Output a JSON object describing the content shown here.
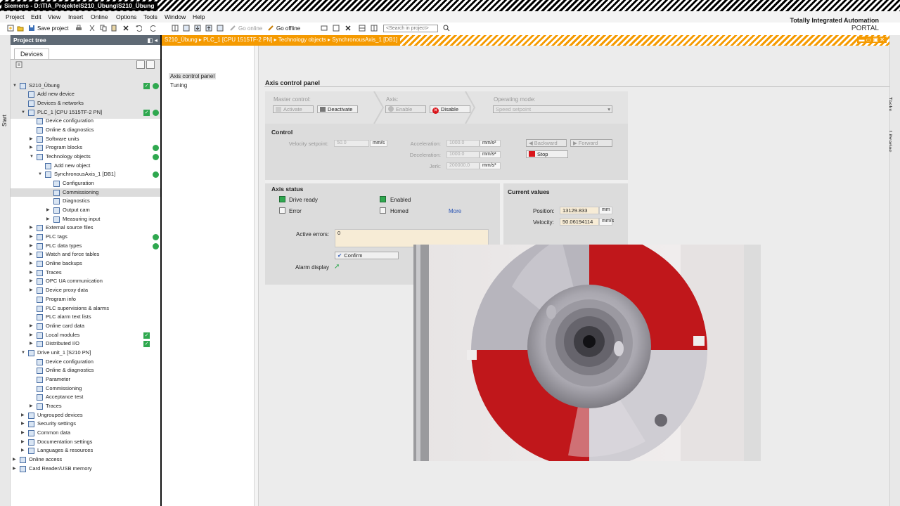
{
  "window": {
    "title": "Siemens - D:\\TIA_Projekte\\S210_Übung\\S210_Übung",
    "brand_line1": "Totally Integrated Automation",
    "brand_line2": "PORTAL"
  },
  "menu": [
    "Project",
    "Edit",
    "View",
    "Insert",
    "Online",
    "Options",
    "Tools",
    "Window",
    "Help"
  ],
  "toolbar": {
    "save_project": "Save project",
    "go_online": "Go online",
    "go_offline": "Go offline",
    "search_placeholder": "<Search in project>"
  },
  "left_strip": "Start",
  "right_strip": {
    "tasks": "Tasks",
    "libraries": "Libraries"
  },
  "project_tree": {
    "header": "Project tree",
    "tab": "Devices",
    "items": [
      {
        "label": "S210_Übung",
        "level": 0,
        "arrow": "down",
        "status": "check-dot"
      },
      {
        "label": "Add new device",
        "level": 1,
        "arrow": ""
      },
      {
        "label": "Devices & networks",
        "level": 1,
        "arrow": ""
      },
      {
        "label": "PLC_1 [CPU 1515TF-2 PN]",
        "level": 1,
        "arrow": "down",
        "status": "check-dot"
      },
      {
        "label": "Device configuration",
        "level": 2,
        "arrow": ""
      },
      {
        "label": "Online & diagnostics",
        "level": 2,
        "arrow": ""
      },
      {
        "label": "Software units",
        "level": 2,
        "arrow": "right"
      },
      {
        "label": "Program blocks",
        "level": 2,
        "arrow": "right",
        "status": "dot"
      },
      {
        "label": "Technology objects",
        "level": 2,
        "arrow": "down",
        "status": "dot"
      },
      {
        "label": "Add new object",
        "level": 3,
        "arrow": ""
      },
      {
        "label": "SynchronousAxis_1 [DB1]",
        "level": 3,
        "arrow": "down",
        "status": "dot"
      },
      {
        "label": "Configuration",
        "level": 4,
        "arrow": ""
      },
      {
        "label": "Commissioning",
        "level": 4,
        "arrow": "",
        "selected": true
      },
      {
        "label": "Diagnostics",
        "level": 4,
        "arrow": ""
      },
      {
        "label": "Output cam",
        "level": 4,
        "arrow": "right"
      },
      {
        "label": "Measuring input",
        "level": 4,
        "arrow": "right"
      },
      {
        "label": "External source files",
        "level": 2,
        "arrow": "right"
      },
      {
        "label": "PLC tags",
        "level": 2,
        "arrow": "right",
        "status": "dot"
      },
      {
        "label": "PLC data types",
        "level": 2,
        "arrow": "right",
        "status": "dot"
      },
      {
        "label": "Watch and force tables",
        "level": 2,
        "arrow": "right"
      },
      {
        "label": "Online backups",
        "level": 2,
        "arrow": "right"
      },
      {
        "label": "Traces",
        "level": 2,
        "arrow": "right"
      },
      {
        "label": "OPC UA communication",
        "level": 2,
        "arrow": "right"
      },
      {
        "label": "Device proxy data",
        "level": 2,
        "arrow": "right"
      },
      {
        "label": "Program info",
        "level": 2,
        "arrow": ""
      },
      {
        "label": "PLC supervisions & alarms",
        "level": 2,
        "arrow": ""
      },
      {
        "label": "PLC alarm text lists",
        "level": 2,
        "arrow": ""
      },
      {
        "label": "Online card data",
        "level": 2,
        "arrow": "right"
      },
      {
        "label": "Local modules",
        "level": 2,
        "arrow": "right",
        "status": "check"
      },
      {
        "label": "Distributed I/O",
        "level": 2,
        "arrow": "right",
        "status": "check"
      },
      {
        "label": "Drive unit_1 [S210 PN]",
        "level": 1,
        "arrow": "down"
      },
      {
        "label": "Device configuration",
        "level": 2,
        "arrow": ""
      },
      {
        "label": "Online & diagnostics",
        "level": 2,
        "arrow": ""
      },
      {
        "label": "Parameter",
        "level": 2,
        "arrow": ""
      },
      {
        "label": "Commissioning",
        "level": 2,
        "arrow": ""
      },
      {
        "label": "Acceptance test",
        "level": 2,
        "arrow": ""
      },
      {
        "label": "Traces",
        "level": 2,
        "arrow": "right"
      },
      {
        "label": "Ungrouped devices",
        "level": 1,
        "arrow": "right"
      },
      {
        "label": "Security settings",
        "level": 1,
        "arrow": "right"
      },
      {
        "label": "Common data",
        "level": 1,
        "arrow": "right"
      },
      {
        "label": "Documentation settings",
        "level": 1,
        "arrow": "right"
      },
      {
        "label": "Languages & resources",
        "level": 1,
        "arrow": "right"
      },
      {
        "label": "Online access",
        "level": 0,
        "arrow": "right"
      },
      {
        "label": "Card Reader/USB memory",
        "level": 0,
        "arrow": "right"
      }
    ]
  },
  "breadcrumb": "S210_Übung ▸ PLC_1 [CPU 1515TF-2 PN] ▸ Technology objects ▸ SynchronousAxis_1 [DB1]",
  "subnav": [
    "Axis control panel",
    "Tuning"
  ],
  "panel": {
    "title": "Axis control panel",
    "master_control": {
      "label": "Master control:",
      "activate": "Activate",
      "deactivate": "Deactivate"
    },
    "axis": {
      "label": "Axis:",
      "enable": "Enable",
      "disable": "Disable"
    },
    "operating_mode": {
      "label": "Operating mode:",
      "value": "Speed setpoint"
    },
    "control": {
      "title": "Control",
      "velocity_setpoint_label": "Velocity setpoint:",
      "velocity_setpoint": "50.0",
      "velocity_unit": "mm/s",
      "acceleration_label": "Acceleration:",
      "acceleration": "1000.0",
      "acceleration_unit": "mm/s²",
      "deceleration_label": "Deceleration:",
      "deceleration": "1000.0",
      "deceleration_unit": "mm/s²",
      "jerk_label": "Jerk:",
      "jerk": "200000.0",
      "jerk_unit": "mm/s³",
      "backward": "Backward",
      "forward": "Forward",
      "stop": "Stop"
    },
    "axis_status": {
      "title": "Axis status",
      "drive_ready": "Drive ready",
      "enabled": "Enabled",
      "error": "Error",
      "homed": "Homed",
      "more": "More",
      "active_errors_label": "Active errors:",
      "active_errors": "0",
      "confirm": "Confirm",
      "alarm_display": "Alarm display"
    },
    "current_values": {
      "title": "Current values",
      "position_label": "Position:",
      "position": "13129.833",
      "position_unit": "mm",
      "velocity_label": "Velocity:",
      "velocity": "50.06194114",
      "velocity_unit": "mm/s"
    }
  },
  "colors": {
    "header_orange": "#f59a00",
    "tree_header": "#5f6a75",
    "status_green": "#2fa84f",
    "disc_red": "#c0171b",
    "stop_red": "#d9151b"
  }
}
